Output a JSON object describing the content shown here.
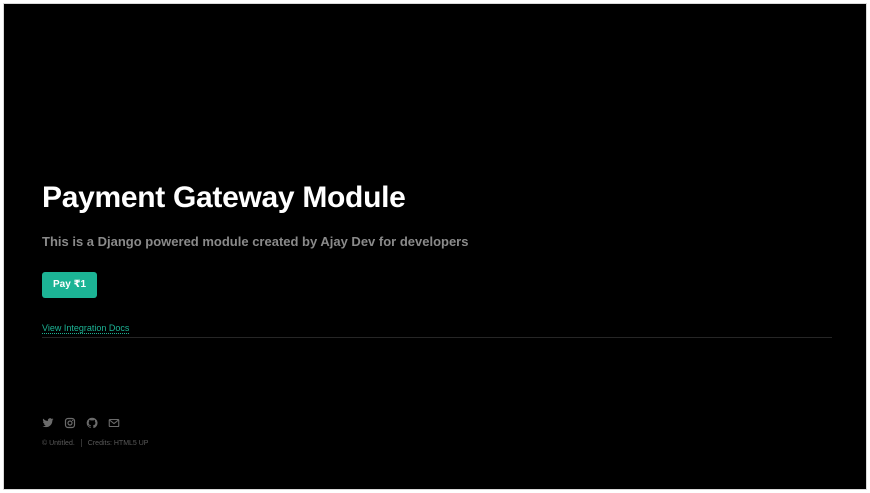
{
  "hero": {
    "title": "Payment Gateway Module",
    "subtitle": "This is a Django powered module created by Ajay Dev for developers",
    "pay_button_label": "Pay ₹1",
    "docs_link_label": "View Integration Docs"
  },
  "footer": {
    "social_icons": [
      "twitter-icon",
      "instagram-icon",
      "github-icon",
      "envelope-icon"
    ],
    "copyright": "© Untitled.",
    "credits": "Credits: HTML5 UP"
  },
  "colors": {
    "background": "#000000",
    "accent": "#1cb495",
    "title": "#ffffff",
    "subtitle": "#8a8a8a"
  }
}
